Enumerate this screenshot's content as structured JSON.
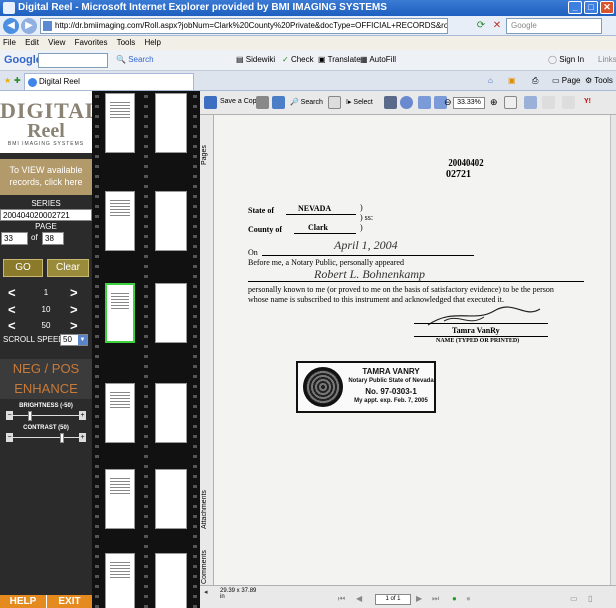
{
  "window": {
    "title": "Digital Reel - Microsoft Internet Explorer provided by BMI IMAGING SYSTEMS",
    "minimize": "_",
    "maximize": "□",
    "close": "✕"
  },
  "address": {
    "url": "http://dr.bmiimaging.com/Roll.aspx?jobNum=Clark%20County%20Private&docType=OFFICIAL+RECORDS&rollName=1799098RollTitle=&bookName=200404020002725&Title=&",
    "search_placeholder": "Google"
  },
  "menu": [
    "File",
    "Edit",
    "View",
    "Favorites",
    "Tools",
    "Help"
  ],
  "googlebar": {
    "logo": "Google",
    "search": "Search",
    "sidewiki": "Sidewiki",
    "check": "Check",
    "translate": "Translate",
    "autofill": "AutoFill",
    "signin": "Sign In",
    "links": "Links"
  },
  "tabs": [
    {
      "label": "Digital Reel"
    }
  ],
  "ie_toolbar": {
    "page": "Page",
    "tools": "Tools"
  },
  "left_panel": {
    "logo_line1": "DIGITAL",
    "logo_line2": "Reel",
    "logo_line3": "BMI IMAGING SYSTEMS",
    "view_records": "To VIEW available records, click here",
    "series_label": "SERIES",
    "series_value": "200404020002721",
    "page_label": "PAGE",
    "page_value": "33",
    "of_label": "of",
    "total_pages": "38",
    "go": "GO",
    "clear": "Clear",
    "nav_steps": [
      "1",
      "10",
      "50"
    ],
    "scroll_speed_label": "SCROLL SPEED:",
    "scroll_speed_value": "50",
    "neg_pos": "NEG / POS",
    "enhance": "ENHANCE",
    "brightness_label": "BRIGHTNESS (-50)",
    "contrast_label": "CONTRAST (50)",
    "brightness": -50,
    "contrast": 50,
    "help": "HELP",
    "exit": "EXIT"
  },
  "viewer": {
    "save_copy": "Save a Copy",
    "search": "Search",
    "select": "Select",
    "zoom": "33.33%",
    "side_tabs": [
      "Pages",
      "Attachments",
      "Comments"
    ],
    "page_size": "29.39 x 37.89 in",
    "page_indicator": "1 of 1"
  },
  "document": {
    "stamp_number_1": "20040402",
    "stamp_number_2": "02721",
    "state_label": "State of",
    "state_value": "NEVADA",
    "ss": "ss:",
    "county_label": "County of",
    "county_value": "Clark",
    "on_label": "On",
    "date_handwritten": "April 1, 2004",
    "before_me": "Before me, a Notary Public, personally appeared",
    "name_handwritten": "Robert L. Bohnenkamp",
    "body_1": "personally known to me (or proved to me on the basis of satisfactory evidence) to be the person",
    "body_2": "whose name is subscribed to this instrument and acknowledged that executed it.",
    "notary_name": "Tamra VanRy",
    "notary_caption": "NAME (TYPED OR PRINTED)",
    "seal_line1": "TAMRA VANRY",
    "seal_line2": "Notary Public State of Nevada",
    "seal_line3": "No. 97-0303-1",
    "seal_line4": "My appt. exp. Feb. 7, 2005"
  }
}
